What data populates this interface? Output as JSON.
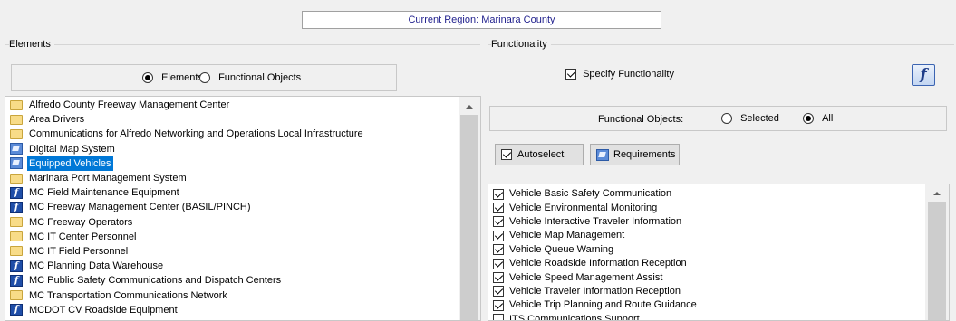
{
  "region": {
    "text": "Current Region: Marinara County"
  },
  "elements": {
    "group_title": "Elements",
    "mode_options": [
      {
        "label": "Elements",
        "selected": true
      },
      {
        "label": "Functional Objects",
        "selected": false
      }
    ],
    "items": [
      {
        "label": "Alfredo County Freeway Management Center",
        "icon": "folder-icon",
        "selected": false
      },
      {
        "label": "Area Drivers",
        "icon": "folder-icon",
        "selected": false
      },
      {
        "label": "Communications for Alfredo Networking and Operations Local Infrastructure",
        "icon": "folder-icon",
        "selected": false
      },
      {
        "label": "Digital Map System",
        "icon": "map-system-icon",
        "selected": false
      },
      {
        "label": "Equipped Vehicles",
        "icon": "map-system-icon",
        "selected": true
      },
      {
        "label": "Marinara Port Management System",
        "icon": "folder-icon",
        "selected": false
      },
      {
        "label": "MC Field Maintenance Equipment",
        "icon": "function-icon",
        "selected": false
      },
      {
        "label": "MC Freeway Management Center (BASIL/PINCH)",
        "icon": "function-icon",
        "selected": false
      },
      {
        "label": "MC Freeway Operators",
        "icon": "folder-icon",
        "selected": false
      },
      {
        "label": "MC IT Center Personnel",
        "icon": "folder-icon",
        "selected": false
      },
      {
        "label": "MC IT Field Personnel",
        "icon": "folder-icon",
        "selected": false
      },
      {
        "label": "MC Planning Data Warehouse",
        "icon": "function-icon",
        "selected": false
      },
      {
        "label": "MC Public Safety Communications and Dispatch Centers",
        "icon": "function-icon",
        "selected": false
      },
      {
        "label": "MC Transportation Communications Network",
        "icon": "folder-icon",
        "selected": false
      },
      {
        "label": "MCDOT CV Roadside Equipment",
        "icon": "function-icon",
        "selected": false
      }
    ]
  },
  "functionality": {
    "group_title": "Functionality",
    "specify_label": "Specify Functionality",
    "specify_checked": true,
    "fo_label": "Functional Objects:",
    "fo_options": [
      {
        "label": "Selected",
        "selected": false
      },
      {
        "label": "All",
        "selected": true
      }
    ],
    "autoselect_label": "Autoselect",
    "requirements_label": "Requirements",
    "big_icon_glyph": "f",
    "items": [
      {
        "label": "Vehicle Basic Safety Communication",
        "checked": true
      },
      {
        "label": "Vehicle Environmental Monitoring",
        "checked": true
      },
      {
        "label": "Vehicle Interactive Traveler Information",
        "checked": true
      },
      {
        "label": "Vehicle Map Management",
        "checked": true
      },
      {
        "label": "Vehicle Queue Warning",
        "checked": true
      },
      {
        "label": "Vehicle Roadside Information Reception",
        "checked": true
      },
      {
        "label": "Vehicle Speed Management Assist",
        "checked": true
      },
      {
        "label": "Vehicle Traveler Information Reception",
        "checked": true
      },
      {
        "label": "Vehicle Trip Planning and Route Guidance",
        "checked": true
      },
      {
        "label": "ITS Communications Support",
        "checked": false
      }
    ]
  },
  "colors": {
    "selection": "#0078d7",
    "region_text": "#1e1e8c"
  }
}
